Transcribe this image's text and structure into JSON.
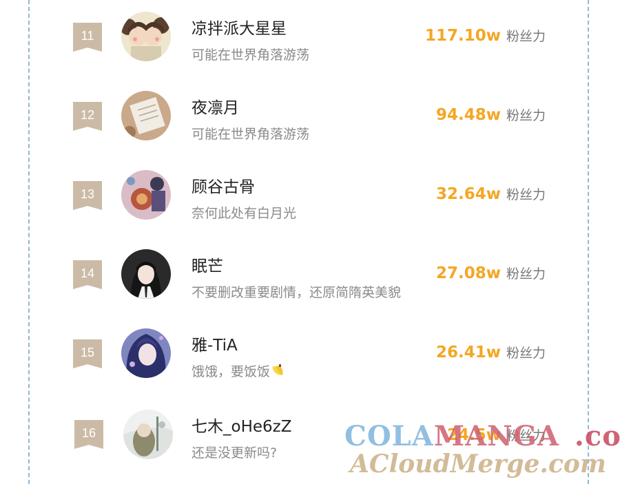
{
  "fans_label": "粉丝力",
  "rows": [
    {
      "rank": "11",
      "name": "凉拌派大星星",
      "desc": "可能在世界角落游荡",
      "fans": "117.10w"
    },
    {
      "rank": "12",
      "name": "夜凛月",
      "desc": "可能在世界角落游荡",
      "fans": "94.48w"
    },
    {
      "rank": "13",
      "name": "顾谷古骨",
      "desc": "奈何此处有白月光",
      "fans": "32.64w"
    },
    {
      "rank": "14",
      "name": "眠芒",
      "desc": "不要删改重要剧情，还原简隋英美貌",
      "fans": "27.08w"
    },
    {
      "rank": "15",
      "name": "雅-TiA",
      "desc": "饿饿，要饭饭",
      "fans": "26.41w"
    },
    {
      "rank": "16",
      "name": "七木_oHe6zZ",
      "desc": "还是没更新吗?",
      "fans": "24.5w"
    }
  ],
  "watermark": {
    "line1_a": "COLA",
    "line1_b": "MANGA",
    "line1_c": ".com",
    "line2": "ACloudMerge.com"
  },
  "colors": {
    "rank_badge": "#cbbba6",
    "fans_value": "#f5a623",
    "frame_dash": "#8fb7d6"
  }
}
